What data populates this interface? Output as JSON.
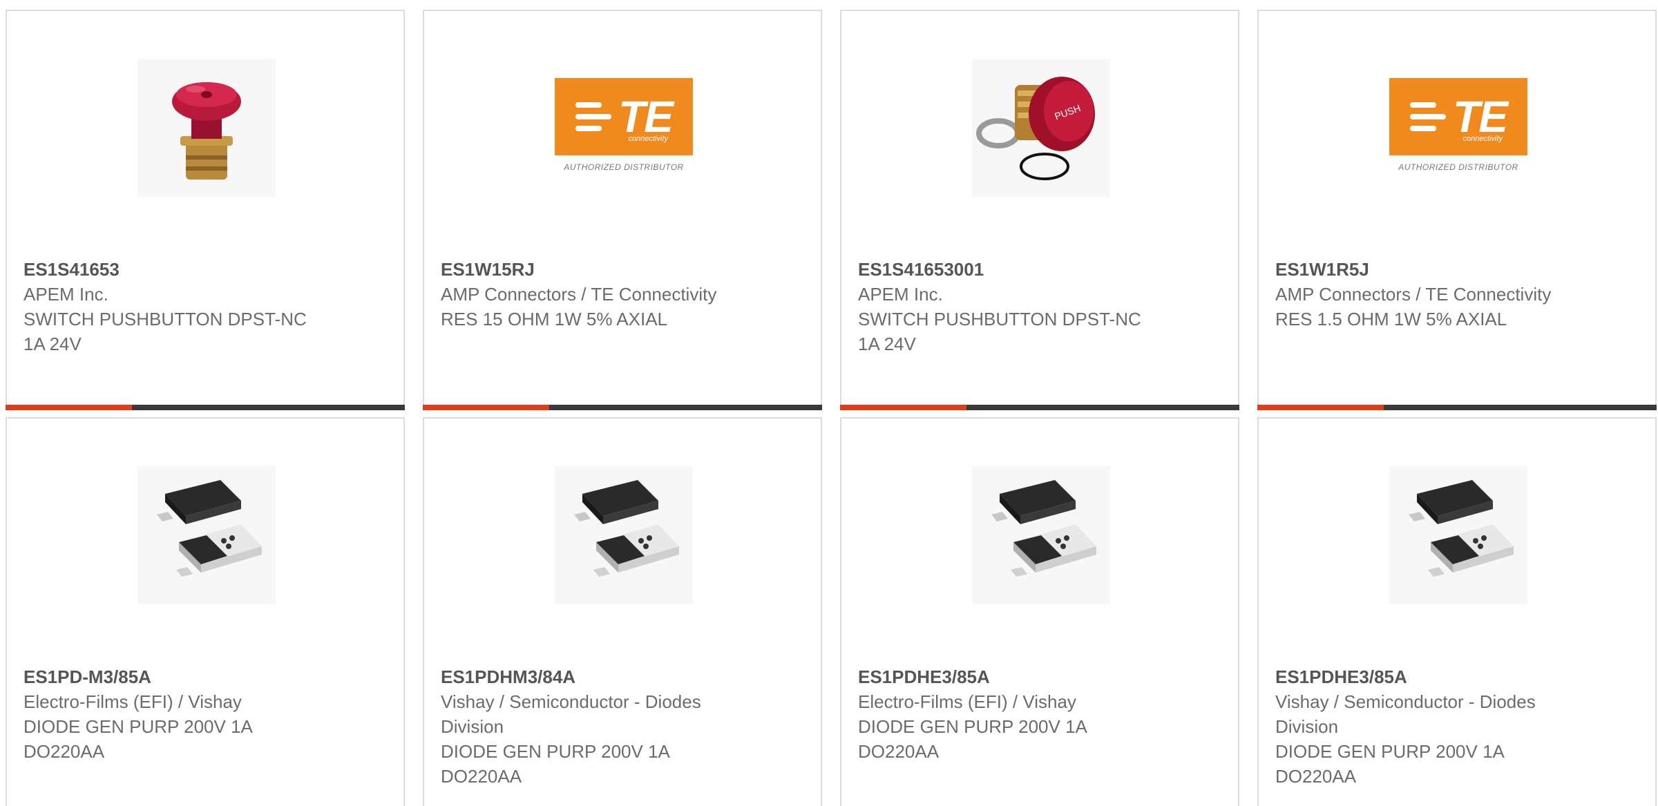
{
  "products": [
    {
      "part": "ES1S41653",
      "mfr": "APEM Inc.",
      "desc": "SWITCH PUSHBUTTON DPST-NC 1A 24V",
      "image": "red-pushbutton-icon"
    },
    {
      "part": "ES1W15RJ",
      "mfr": "AMP Connectors / TE Connectivity",
      "desc": "RES 15 OHM 1W 5% AXIAL",
      "image": "te-logo"
    },
    {
      "part": "ES1S41653001",
      "mfr": "APEM Inc.",
      "desc": "SWITCH PUSHBUTTON DPST-NC 1A 24V",
      "image": "red-push-switch-icon"
    },
    {
      "part": "ES1W1R5J",
      "mfr": "AMP Connectors / TE Connectivity",
      "desc": "RES 1.5 OHM 1W 5% AXIAL",
      "image": "te-logo"
    },
    {
      "part": "ES1PD-M3/85A",
      "mfr": "Electro-Films (EFI) / Vishay",
      "desc": "DIODE GEN PURP 200V 1A DO220AA",
      "image": "smd-diode-icon"
    },
    {
      "part": "ES1PDHM3/84A",
      "mfr": "Vishay / Semiconductor - Diodes Division",
      "desc": "DIODE GEN PURP 200V 1A DO220AA",
      "image": "smd-diode-icon"
    },
    {
      "part": "ES1PDHE3/85A",
      "mfr": "Electro-Films (EFI) / Vishay",
      "desc": "DIODE GEN PURP 200V 1A DO220AA",
      "image": "smd-diode-icon"
    },
    {
      "part": "ES1PDHE3/85A",
      "mfr": "Vishay / Semiconductor - Diodes Division",
      "desc": "DIODE GEN PURP 200V 1A DO220AA",
      "image": "smd-diode-icon"
    }
  ],
  "te_logo": {
    "text": "TE",
    "sub": "connectivity",
    "tagline": "AUTHORIZED DISTRIBUTOR"
  },
  "colors": {
    "accent": "#e03e1a",
    "bar": "#3a3a3a",
    "te_orange": "#f08a1f"
  }
}
